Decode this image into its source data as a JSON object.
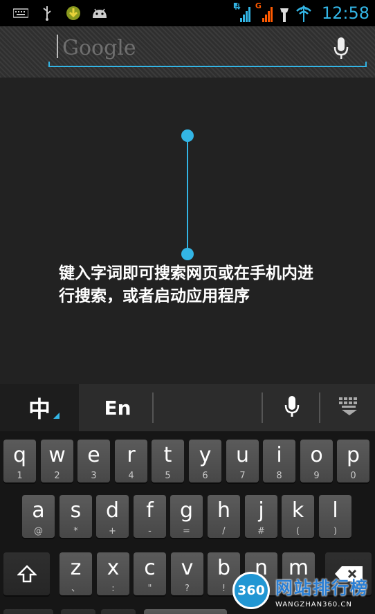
{
  "status_bar": {
    "icons_left": [
      "keyboard-icon",
      "usb-icon",
      "download-icon",
      "android-icon"
    ],
    "network_labels": [
      "E",
      "G"
    ],
    "time": "12:58"
  },
  "search": {
    "placeholder": "Google",
    "mic_icon": "mic-icon",
    "accent": "#33b5e5"
  },
  "hint": {
    "text": "键入字词即可搜索网页或在手机内进行搜索，或者启动应用程序"
  },
  "candidate_bar": {
    "chinese": "中",
    "english": "En",
    "mic_icon": "mic-icon",
    "hide_icon": "keyboard-hide-icon"
  },
  "keyboard": {
    "row1": [
      {
        "k": "q",
        "s": "1"
      },
      {
        "k": "w",
        "s": "2"
      },
      {
        "k": "e",
        "s": "3"
      },
      {
        "k": "r",
        "s": "4"
      },
      {
        "k": "t",
        "s": "5"
      },
      {
        "k": "y",
        "s": "6"
      },
      {
        "k": "u",
        "s": "7"
      },
      {
        "k": "i",
        "s": "8"
      },
      {
        "k": "o",
        "s": "9"
      },
      {
        "k": "p",
        "s": "0"
      }
    ],
    "row2": [
      {
        "k": "a",
        "s": "@"
      },
      {
        "k": "s",
        "s": "*"
      },
      {
        "k": "d",
        "s": "+"
      },
      {
        "k": "f",
        "s": "-"
      },
      {
        "k": "g",
        "s": "="
      },
      {
        "k": "h",
        "s": "/"
      },
      {
        "k": "j",
        "s": "#"
      },
      {
        "k": "k",
        "s": "("
      },
      {
        "k": "l",
        "s": ")"
      }
    ],
    "row3": [
      {
        "k": "z",
        "s": "、"
      },
      {
        "k": "x",
        "s": ":"
      },
      {
        "k": "c",
        "s": "\""
      },
      {
        "k": "v",
        "s": "?"
      },
      {
        "k": "b",
        "s": "!"
      },
      {
        "k": "n",
        "s": "~"
      },
      {
        "k": "m",
        "s": "…"
      }
    ]
  },
  "watermark": {
    "number": "360",
    "title": "网站排行榜",
    "subtitle": "WANGZHAN360.CN"
  }
}
